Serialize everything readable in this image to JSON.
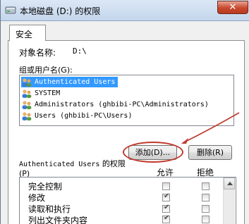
{
  "window": {
    "title": "本地磁盘 (D:) 的权限",
    "close_symbol": "✕"
  },
  "tabs": [
    {
      "label": "安全"
    }
  ],
  "object": {
    "label": "对象名称:",
    "value": "D:\\"
  },
  "groups": {
    "label": "组或用户名(G):",
    "items": [
      {
        "label": "Authenticated Users",
        "selected": true
      },
      {
        "label": "SYSTEM",
        "selected": false
      },
      {
        "label": "Administrators (ghbibi-PC\\Administrators)",
        "selected": false
      },
      {
        "label": "Users (ghbibi-PC\\Users)",
        "selected": false
      }
    ]
  },
  "buttons": {
    "add_label": "添加(D)...",
    "remove_label": "删除(R)"
  },
  "permissions": {
    "label_line1_mono": "Authenticated Users",
    "label_line1_text": " 的权限",
    "label_line2": "(P)",
    "allow_header": "允许",
    "deny_header": "拒绝",
    "rows": [
      {
        "name": "完全控制",
        "allow": false,
        "deny": false
      },
      {
        "name": "修改",
        "allow": true,
        "deny": false
      },
      {
        "name": "读取和执行",
        "allow": true,
        "deny": false
      },
      {
        "name": "列出文件夹内容",
        "allow": true,
        "deny": false
      }
    ]
  },
  "annotation": {
    "color": "#c0392b"
  }
}
